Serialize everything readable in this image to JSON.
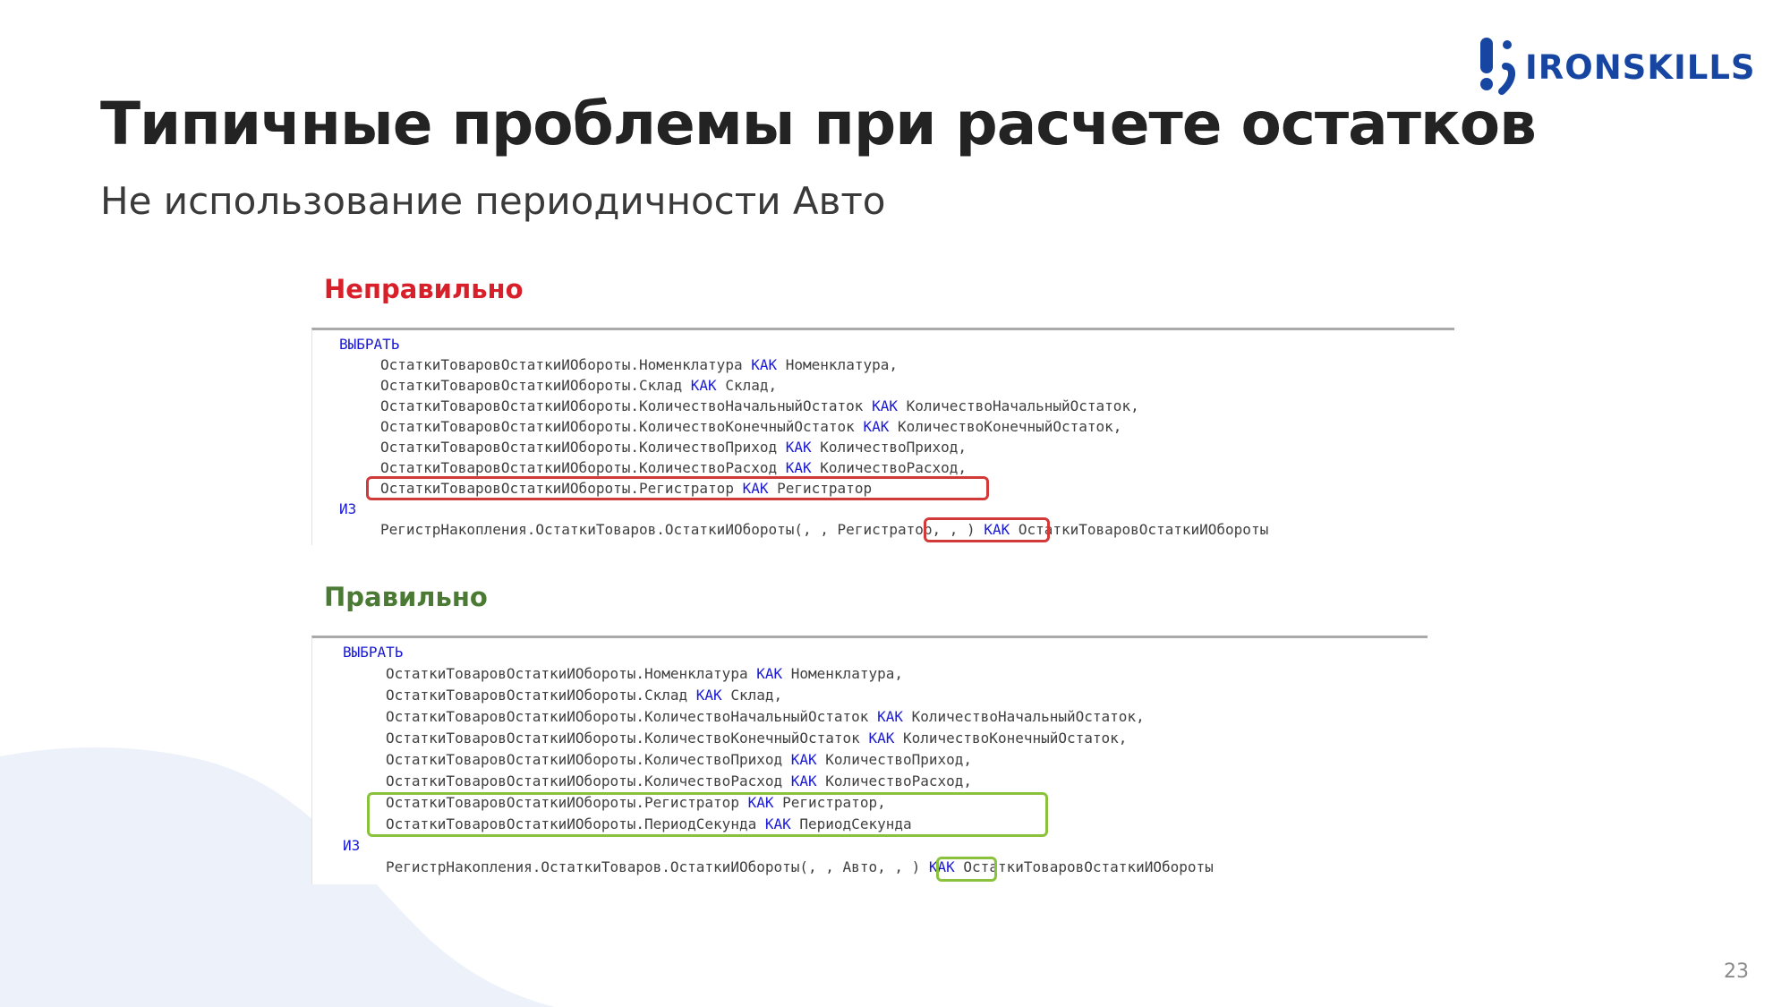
{
  "brand": {
    "name": "IRONSKILLS",
    "color": "#1746a2"
  },
  "title": "Типичные проблемы при расчете остатков",
  "subtitle": "Не использование периодичности Авто",
  "wrong": {
    "label": "Неправильно",
    "label_color": "#d8202a",
    "lines": [
      {
        "indent": 0,
        "parts": [
          {
            "t": "ВЫБРАТЬ",
            "kw": true
          }
        ]
      },
      {
        "indent": 1,
        "parts": [
          {
            "t": "ОстаткиТоваровОстаткиИОбороты.Номенклатура "
          },
          {
            "t": "КАК",
            "kw": true
          },
          {
            "t": " Номенклатура,"
          }
        ]
      },
      {
        "indent": 1,
        "parts": [
          {
            "t": "ОстаткиТоваровОстаткиИОбороты.Склад "
          },
          {
            "t": "КАК",
            "kw": true
          },
          {
            "t": " Склад,"
          }
        ]
      },
      {
        "indent": 1,
        "parts": [
          {
            "t": "ОстаткиТоваровОстаткиИОбороты.КоличествоНачальныйОстаток "
          },
          {
            "t": "КАК",
            "kw": true
          },
          {
            "t": " КоличествоНачальныйОстаток,"
          }
        ]
      },
      {
        "indent": 1,
        "parts": [
          {
            "t": "ОстаткиТоваровОстаткиИОбороты.КоличествоКонечныйОстаток "
          },
          {
            "t": "КАК",
            "kw": true
          },
          {
            "t": " КоличествоКонечныйОстаток,"
          }
        ]
      },
      {
        "indent": 1,
        "parts": [
          {
            "t": "ОстаткиТоваровОстаткиИОбороты.КоличествоПриход "
          },
          {
            "t": "КАК",
            "kw": true
          },
          {
            "t": " КоличествоПриход,"
          }
        ]
      },
      {
        "indent": 1,
        "parts": [
          {
            "t": "ОстаткиТоваровОстаткиИОбороты.КоличествоРасход "
          },
          {
            "t": "КАК",
            "kw": true
          },
          {
            "t": " КоличествоРасход,"
          }
        ]
      },
      {
        "indent": 1,
        "parts": [
          {
            "t": "ОстаткиТоваровОстаткиИОбороты.Регистратор "
          },
          {
            "t": "КАК",
            "kw": true
          },
          {
            "t": " Регистратор"
          }
        ]
      },
      {
        "indent": 0,
        "parts": [
          {
            "t": "ИЗ",
            "kw": true
          }
        ]
      },
      {
        "indent": 1,
        "parts": [
          {
            "t": "РегистрНакопления.ОстаткиТоваров.ОстаткиИОбороты(, , "
          },
          {
            "t": "Регистратор"
          },
          {
            "t": ", , ) "
          },
          {
            "t": "КАК",
            "kw": true
          },
          {
            "t": " ОстаткиТоваровОстаткиИОбороты"
          }
        ]
      }
    ],
    "highlight_color": "#d23a3a"
  },
  "right": {
    "label": "Правильно",
    "label_color": "#4a7a33",
    "lines": [
      {
        "indent": 0,
        "parts": [
          {
            "t": "ВЫБРАТЬ",
            "kw": true
          }
        ]
      },
      {
        "indent": 1,
        "parts": [
          {
            "t": "ОстаткиТоваровОстаткиИОбороты.Номенклатура "
          },
          {
            "t": "КАК",
            "kw": true
          },
          {
            "t": " Номенклатура,"
          }
        ]
      },
      {
        "indent": 1,
        "parts": [
          {
            "t": "ОстаткиТоваровОстаткиИОбороты.Склад "
          },
          {
            "t": "КАК",
            "kw": true
          },
          {
            "t": " Склад,"
          }
        ]
      },
      {
        "indent": 1,
        "parts": [
          {
            "t": "ОстаткиТоваровОстаткиИОбороты.КоличествоНачальныйОстаток "
          },
          {
            "t": "КАК",
            "kw": true
          },
          {
            "t": " КоличествоНачальныйОстаток,"
          }
        ]
      },
      {
        "indent": 1,
        "parts": [
          {
            "t": "ОстаткиТоваровОстаткиИОбороты.КоличествоКонечныйОстаток "
          },
          {
            "t": "КАК",
            "kw": true
          },
          {
            "t": " КоличествоКонечныйОстаток,"
          }
        ]
      },
      {
        "indent": 1,
        "parts": [
          {
            "t": "ОстаткиТоваровОстаткиИОбороты.КоличествоПриход "
          },
          {
            "t": "КАК",
            "kw": true
          },
          {
            "t": " КоличествоПриход,"
          }
        ]
      },
      {
        "indent": 1,
        "parts": [
          {
            "t": "ОстаткиТоваровОстаткиИОбороты.КоличествоРасход "
          },
          {
            "t": "КАК",
            "kw": true
          },
          {
            "t": " КоличествоРасход,"
          }
        ]
      },
      {
        "indent": 1,
        "parts": [
          {
            "t": "ОстаткиТоваровОстаткиИОбороты.Регистратор "
          },
          {
            "t": "КАК",
            "kw": true
          },
          {
            "t": " Регистратор,"
          }
        ]
      },
      {
        "indent": 1,
        "parts": [
          {
            "t": "ОстаткиТоваровОстаткиИОбороты.ПериодСекунда "
          },
          {
            "t": "КАК",
            "kw": true
          },
          {
            "t": " ПериодСекунда"
          }
        ]
      },
      {
        "indent": 0,
        "parts": [
          {
            "t": "ИЗ",
            "kw": true
          }
        ]
      },
      {
        "indent": 1,
        "parts": [
          {
            "t": "РегистрНакопления.ОстаткиТоваров.ОстаткиИОбороты(, , "
          },
          {
            "t": "Авто"
          },
          {
            "t": ", , ) "
          },
          {
            "t": "КАК",
            "kw": true
          },
          {
            "t": " ОстаткиТоваровОстаткиИОбороты"
          }
        ]
      }
    ],
    "highlight_color": "#8ac23d"
  },
  "page_number": "23"
}
